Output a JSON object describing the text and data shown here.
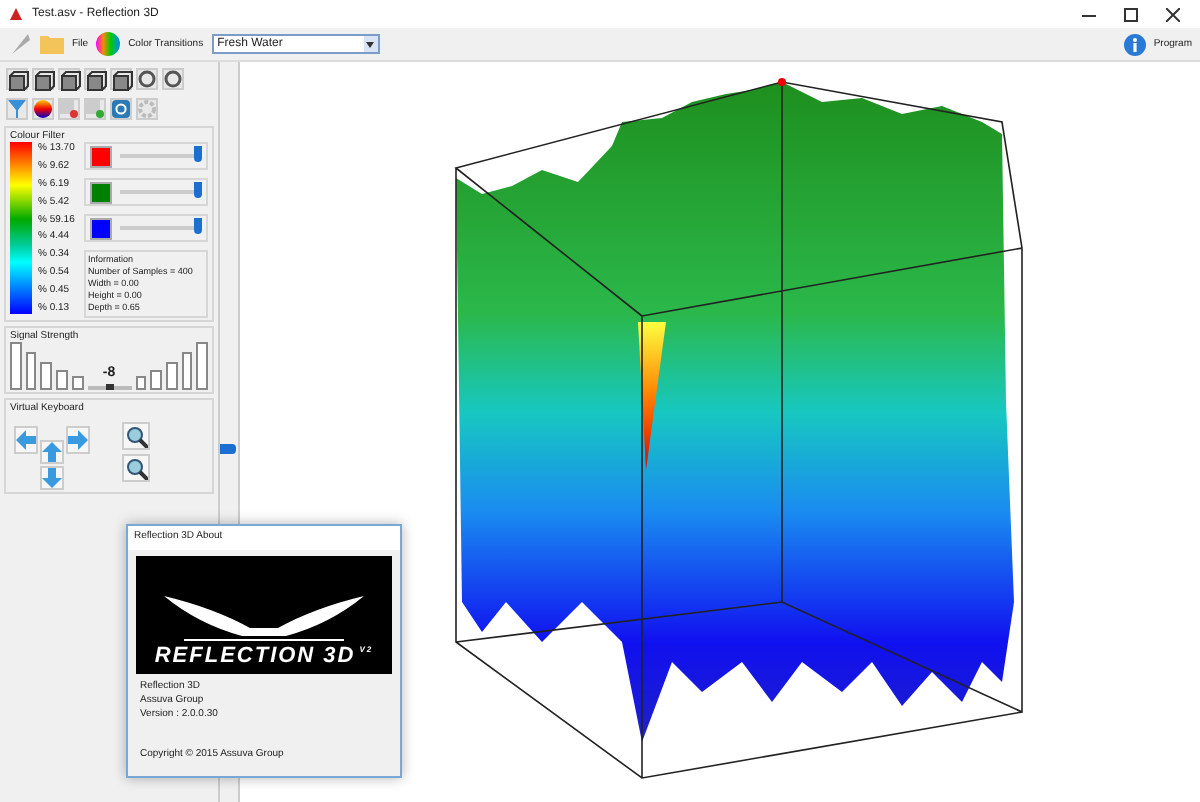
{
  "window": {
    "title": "Test.asv - Reflection 3D"
  },
  "toolbar": {
    "file_label": "File",
    "transitions_label": "Color Transitions",
    "water_select": {
      "value": "Fresh Water"
    },
    "program_label": "Program"
  },
  "colour_filter": {
    "title": "Colour Filter",
    "scale": [
      "% 13.70",
      "% 9.62",
      "% 6.19",
      "% 5.42",
      "% 59.16",
      "% 4.44",
      "% 0.34",
      "% 0.54",
      "% 0.45",
      "% 0.13"
    ],
    "channels": [
      {
        "color": "#ff0000",
        "level": 0.95
      },
      {
        "color": "#008000",
        "level": 0.95
      },
      {
        "color": "#0000ff",
        "level": 0.95
      }
    ],
    "information": {
      "title": "Information",
      "lines": [
        "Number of Samples = 400",
        "Width =  0.00",
        "Height = 0.00",
        "Depth = 0.65"
      ]
    }
  },
  "signal_strength": {
    "title": "Signal Strength",
    "reading": "-8",
    "level": 0.5
  },
  "virtual_keyboard": {
    "title": "Virtual Keyboard"
  },
  "about_dialog": {
    "title": "Reflection 3D About",
    "logo_text": "REFLECTION 3D",
    "logo_version": "V2",
    "lines": [
      "Reflection 3D",
      "Assuva Group",
      "Version : 2.0.0.30"
    ],
    "copyright": "Copyright ©  2015 Assuva Group"
  }
}
